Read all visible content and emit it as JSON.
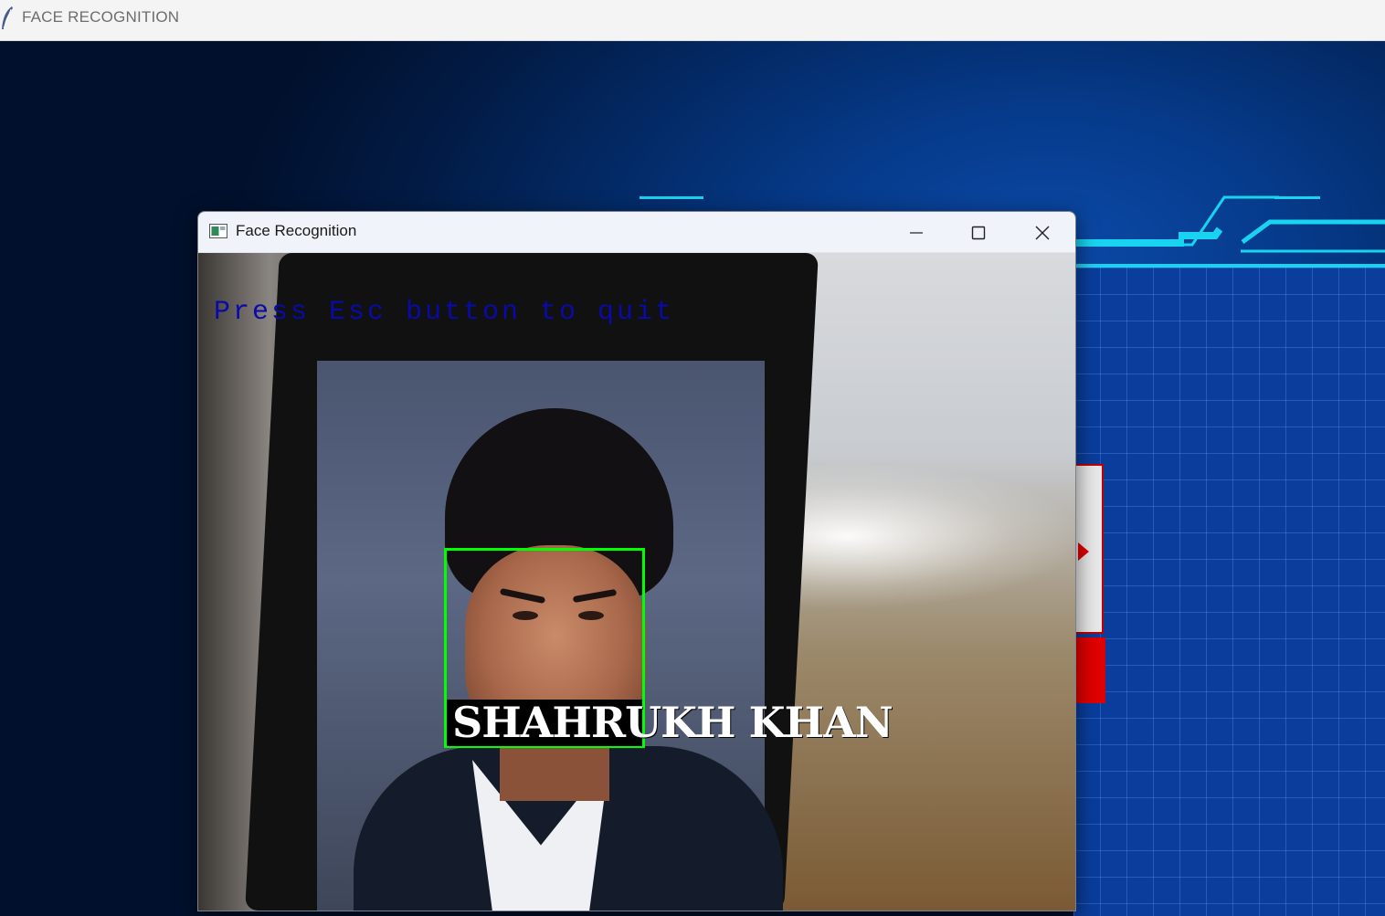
{
  "outer_window": {
    "title": "FACE RECOGNITION"
  },
  "cv_window": {
    "title": "Face Recognition",
    "controls": {
      "minimize": "minimize-icon",
      "maximize": "maximize-icon",
      "close": "close-icon"
    }
  },
  "feed": {
    "hint": "Press Esc button to quit",
    "recognized_name": "SHAHRUKH KHAN",
    "box_color": "#00ff00",
    "hint_color": "#0a0aa8"
  },
  "colors": {
    "accent_cyan": "#19d4f0",
    "alert_red": "#e00000"
  }
}
